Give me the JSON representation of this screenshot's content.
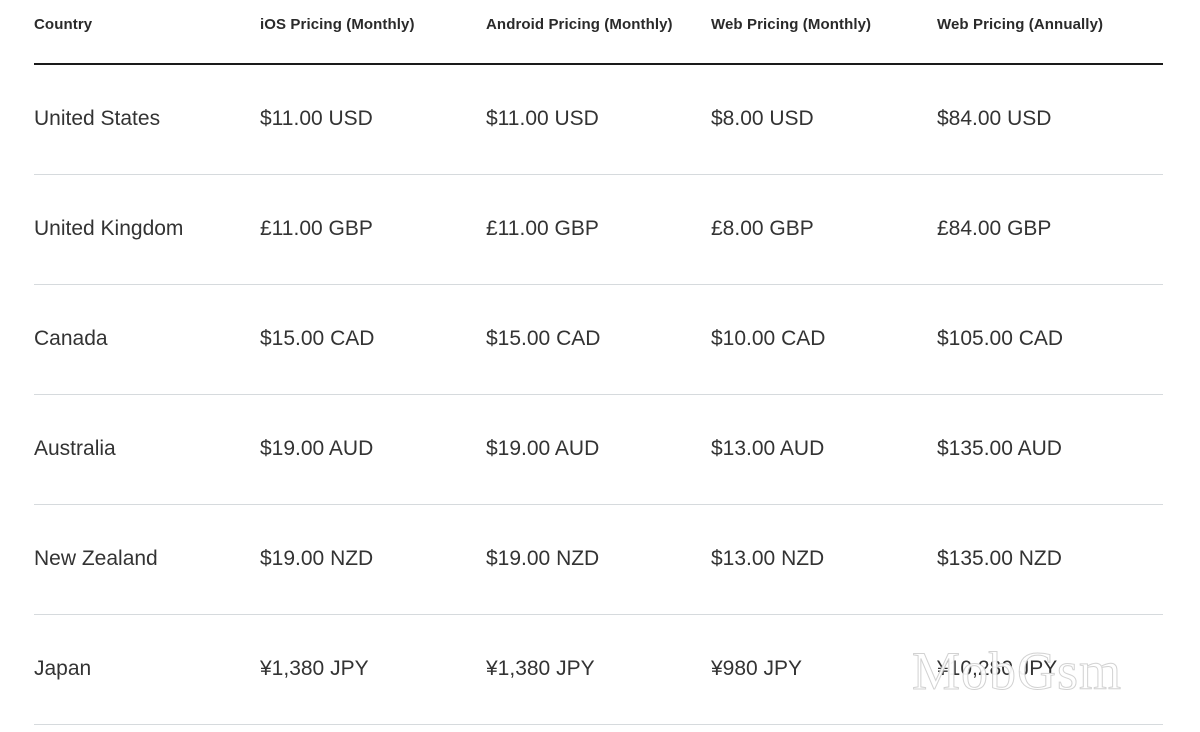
{
  "table": {
    "headers": [
      "Country",
      "iOS Pricing (Monthly)",
      "Android Pricing (Monthly)",
      "Web Pricing (Monthly)",
      "Web Pricing (Annually)"
    ],
    "rows": [
      [
        "United States",
        "$11.00 USD",
        "$11.00 USD",
        "$8.00 USD",
        "$84.00 USD"
      ],
      [
        "United Kingdom",
        "£11.00 GBP",
        "£11.00 GBP",
        "£8.00 GBP",
        "£84.00 GBP"
      ],
      [
        "Canada",
        "$15.00 CAD",
        "$15.00 CAD",
        "$10.00 CAD",
        "$105.00 CAD"
      ],
      [
        "Australia",
        "$19.00 AUD",
        "$19.00 AUD",
        "$13.00 AUD",
        "$135.00 AUD"
      ],
      [
        "New Zealand",
        "$19.00 NZD",
        "$19.00 NZD",
        "$13.00 NZD",
        "$135.00 NZD"
      ],
      [
        "Japan",
        "¥1,380 JPY",
        "¥1,380 JPY",
        "¥980 JPY",
        "¥10,280 JPY"
      ]
    ]
  },
  "watermark": "MobGsm"
}
